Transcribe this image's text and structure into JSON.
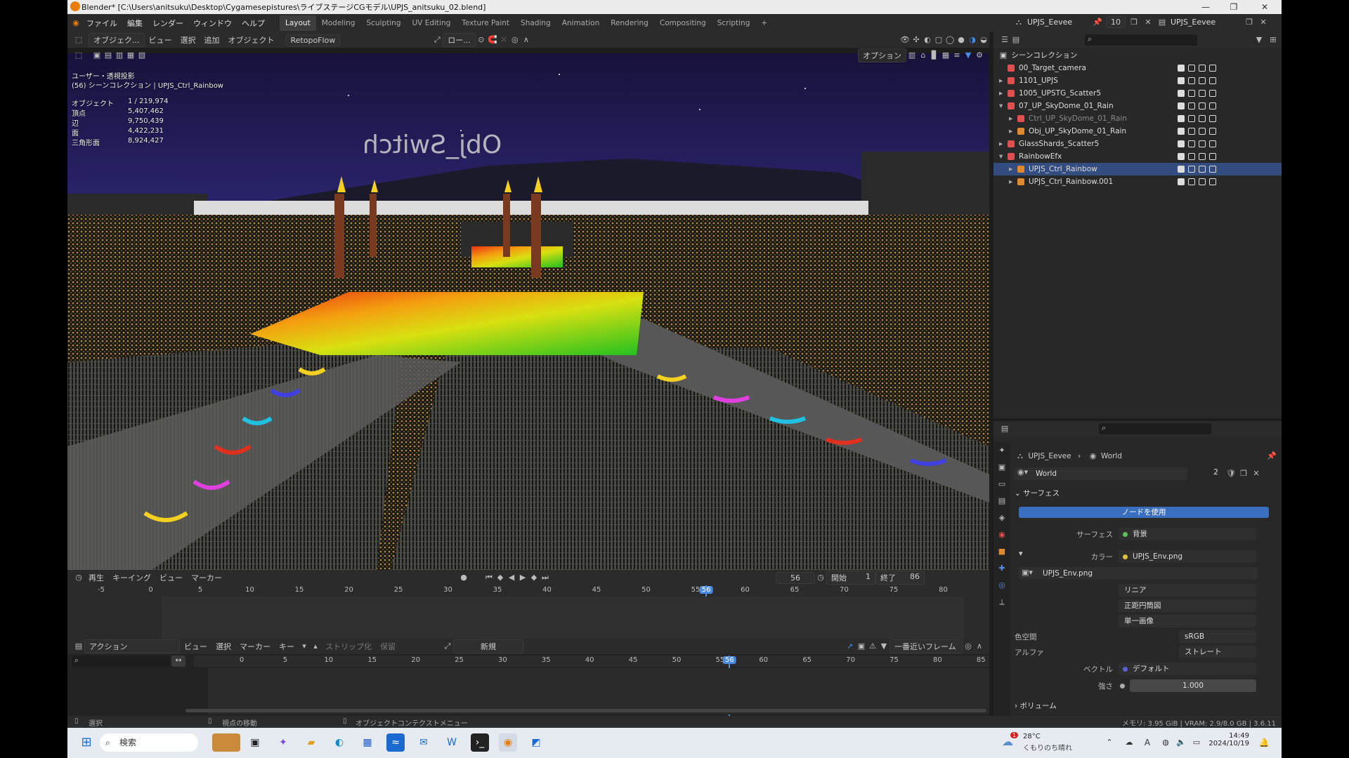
{
  "titlebar": {
    "title": "Blender* [C:\\Users\\anitsuku\\Desktop\\Cygamesepistures\\ライブステージCGモデル\\UPJS_anitsuku_02.blend]",
    "minimize": "—",
    "restore": "❐",
    "close": "✕"
  },
  "menu": {
    "items": [
      "ファイル",
      "編集",
      "レンダー",
      "ウィンドウ",
      "ヘルプ"
    ],
    "workspaces": [
      "Layout",
      "Modeling",
      "Sculpting",
      "UV Editing",
      "Texture Paint",
      "Shading",
      "Animation",
      "Rendering",
      "Compositing",
      "Scripting"
    ],
    "add_tab": "+",
    "scene": "UPJS_Eevee",
    "scene_users": "10",
    "view_layer": "UPJS_Eevee"
  },
  "viewport": {
    "mode": "オブジェク...",
    "menus": [
      "ビュー",
      "選択",
      "追加",
      "オブジェクト"
    ],
    "addon": "RetopoFlow",
    "transform": "ロー...",
    "options": "オプション",
    "view_name": "ユーザー・透視投影",
    "collection_info": "(56) シーンコレクション | UPJS_Ctrl_Rainbow",
    "stats": [
      {
        "label": "オブジェクト",
        "value": "1 / 219,974"
      },
      {
        "label": "頂点",
        "value": "5,407,462"
      },
      {
        "label": "辺",
        "value": "9,750,439"
      },
      {
        "label": "面",
        "value": "4,422,231"
      },
      {
        "label": "三角形面",
        "value": "8,924,427"
      }
    ],
    "scene_text": "Obj_Switch"
  },
  "timeline": {
    "menus": [
      "再生",
      "キーイング",
      "ビュー",
      "マーカー"
    ],
    "current_frame": "56",
    "start_label": "開始",
    "start": "1",
    "end_label": "終了",
    "end": "86",
    "ticks": [
      "-5",
      "0",
      "5",
      "10",
      "15",
      "20",
      "25",
      "30",
      "35",
      "40",
      "45",
      "50",
      "55",
      "60",
      "65",
      "70",
      "75",
      "80"
    ],
    "cursor": "56"
  },
  "action_editor": {
    "mode": "アクション",
    "menus": [
      "ビュー",
      "選択",
      "マーカー",
      "キー"
    ],
    "strip": "ストリップ化",
    "hold": "保留",
    "new_label": "新規",
    "snap": "一番近いフレーム",
    "ticks": [
      "0",
      "5",
      "10",
      "15",
      "20",
      "25",
      "30",
      "35",
      "40",
      "45",
      "50",
      "55",
      "60",
      "65",
      "70",
      "75",
      "80",
      "85"
    ],
    "cursor": "56"
  },
  "outliner": {
    "root": "シーンコレクション",
    "rows": [
      {
        "name": "00_Target_camera",
        "indent": 1,
        "expand": ""
      },
      {
        "name": "1101_UPJS",
        "indent": 1,
        "expand": "▸"
      },
      {
        "name": "1005_UPSTG_Scatter5",
        "indent": 1,
        "expand": "▸"
      },
      {
        "name": "07_UP_SkyDome_01_Rain",
        "indent": 1,
        "expand": "▾"
      },
      {
        "name": "Ctrl_UP_SkyDome_01_Rain",
        "indent": 2,
        "expand": "▸"
      },
      {
        "name": "Obj_UP_SkyDome_01_Rain",
        "indent": 2,
        "expand": "▸"
      },
      {
        "name": "GlassShards_Scatter5",
        "indent": 1,
        "expand": "▸"
      },
      {
        "name": "RainbowEfx",
        "indent": 1,
        "expand": "▾"
      },
      {
        "name": "UPJS_Ctrl_Rainbow",
        "indent": 2,
        "expand": "▸"
      },
      {
        "name": "UPJS_Ctrl_Rainbow.001",
        "indent": 2,
        "expand": "▸"
      }
    ]
  },
  "properties": {
    "breadcrumb_scene": "UPJS_Eevee",
    "breadcrumb_world": "World",
    "world_name": "World",
    "world_users": "2",
    "surface_panel": "サーフェス",
    "use_nodes": "ノードを使用",
    "surface_label": "サーフェス",
    "surface_value": "背景",
    "color_label": "カラー",
    "color_value": "UPJS_Env.png",
    "image_name": "UPJS_Env.png",
    "interp": "リニア",
    "projection": "正距円筒図",
    "single": "単一画像",
    "colorspace_label": "色空間",
    "colorspace": "sRGB",
    "alpha_label": "アルファ",
    "alpha": "ストレート",
    "vector_label": "ベクトル",
    "vector": "デフォルト",
    "strength_label": "強さ",
    "strength": "1.000",
    "volume_panel": "ボリューム"
  },
  "statusbar": {
    "select": "選択",
    "move_view": "視点の移動",
    "context_menu": "オブジェクトコンテクストメニュー",
    "memory": "メモリ: 3.95 GiB | VRAM: 2.9/8.0 GB | 3.6.11"
  },
  "taskbar": {
    "search": "検索",
    "weather_temp": "28°C",
    "weather_desc": "くもりのち晴れ",
    "weather_badge": "1",
    "ime": "A",
    "time": "14:49",
    "date": "2024/10/19"
  },
  "colors": {
    "accent": "#4a8be0",
    "selected_row": "#334d80",
    "use_nodes": "#3a6fc0"
  }
}
